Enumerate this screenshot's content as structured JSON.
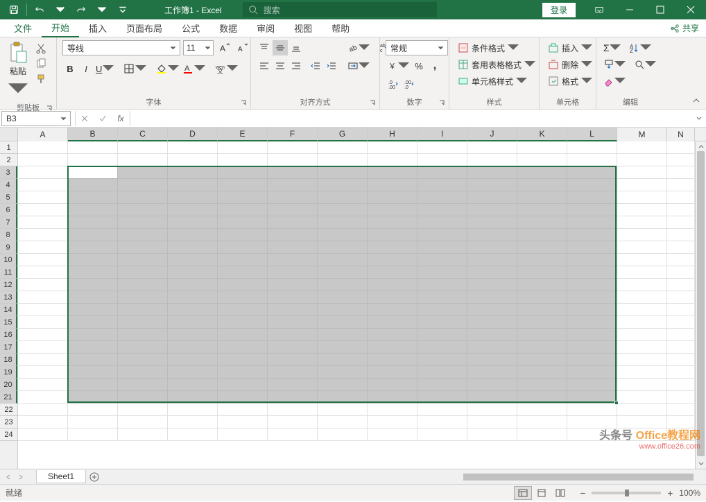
{
  "titlebar": {
    "workbook_name": "工作簿1",
    "app_name": "Excel",
    "title_separator": " - ",
    "search_placeholder": "搜索",
    "login_label": "登录"
  },
  "tabs": {
    "file": "文件",
    "items": [
      "开始",
      "插入",
      "页面布局",
      "公式",
      "数据",
      "审阅",
      "视图",
      "帮助"
    ],
    "active": "开始",
    "share_label": "共享"
  },
  "ribbon": {
    "clipboard": {
      "group_label": "剪贴板",
      "paste": "粘贴"
    },
    "font": {
      "group_label": "字体",
      "name": "等线",
      "size": "11"
    },
    "alignment": {
      "group_label": "对齐方式"
    },
    "number": {
      "group_label": "数字",
      "format": "常规"
    },
    "styles": {
      "group_label": "样式",
      "conditional": "条件格式",
      "table": "套用表格格式",
      "cell": "单元格样式"
    },
    "cells": {
      "group_label": "单元格",
      "insert": "插入",
      "delete": "删除",
      "format": "格式"
    },
    "editing": {
      "group_label": "编辑"
    }
  },
  "formula_bar": {
    "name_box": "B3",
    "formula": ""
  },
  "grid": {
    "columns": [
      "A",
      "B",
      "C",
      "D",
      "E",
      "F",
      "G",
      "H",
      "I",
      "J",
      "K",
      "L",
      "M",
      "N"
    ],
    "selected_columns": [
      "B",
      "C",
      "D",
      "E",
      "F",
      "G",
      "H",
      "I",
      "J",
      "K",
      "L"
    ],
    "row_count": 24,
    "selected_rows_start": 3,
    "selected_rows_end": 21,
    "active_cell": "B3"
  },
  "sheets": {
    "active": "Sheet1",
    "tabs": [
      "Sheet1"
    ]
  },
  "status": {
    "ready": "就绪",
    "zoom": "100%"
  },
  "watermark": {
    "line1_prefix": "头条号",
    "line1_brand": "Office教程网",
    "line2": "www.office26.com"
  }
}
